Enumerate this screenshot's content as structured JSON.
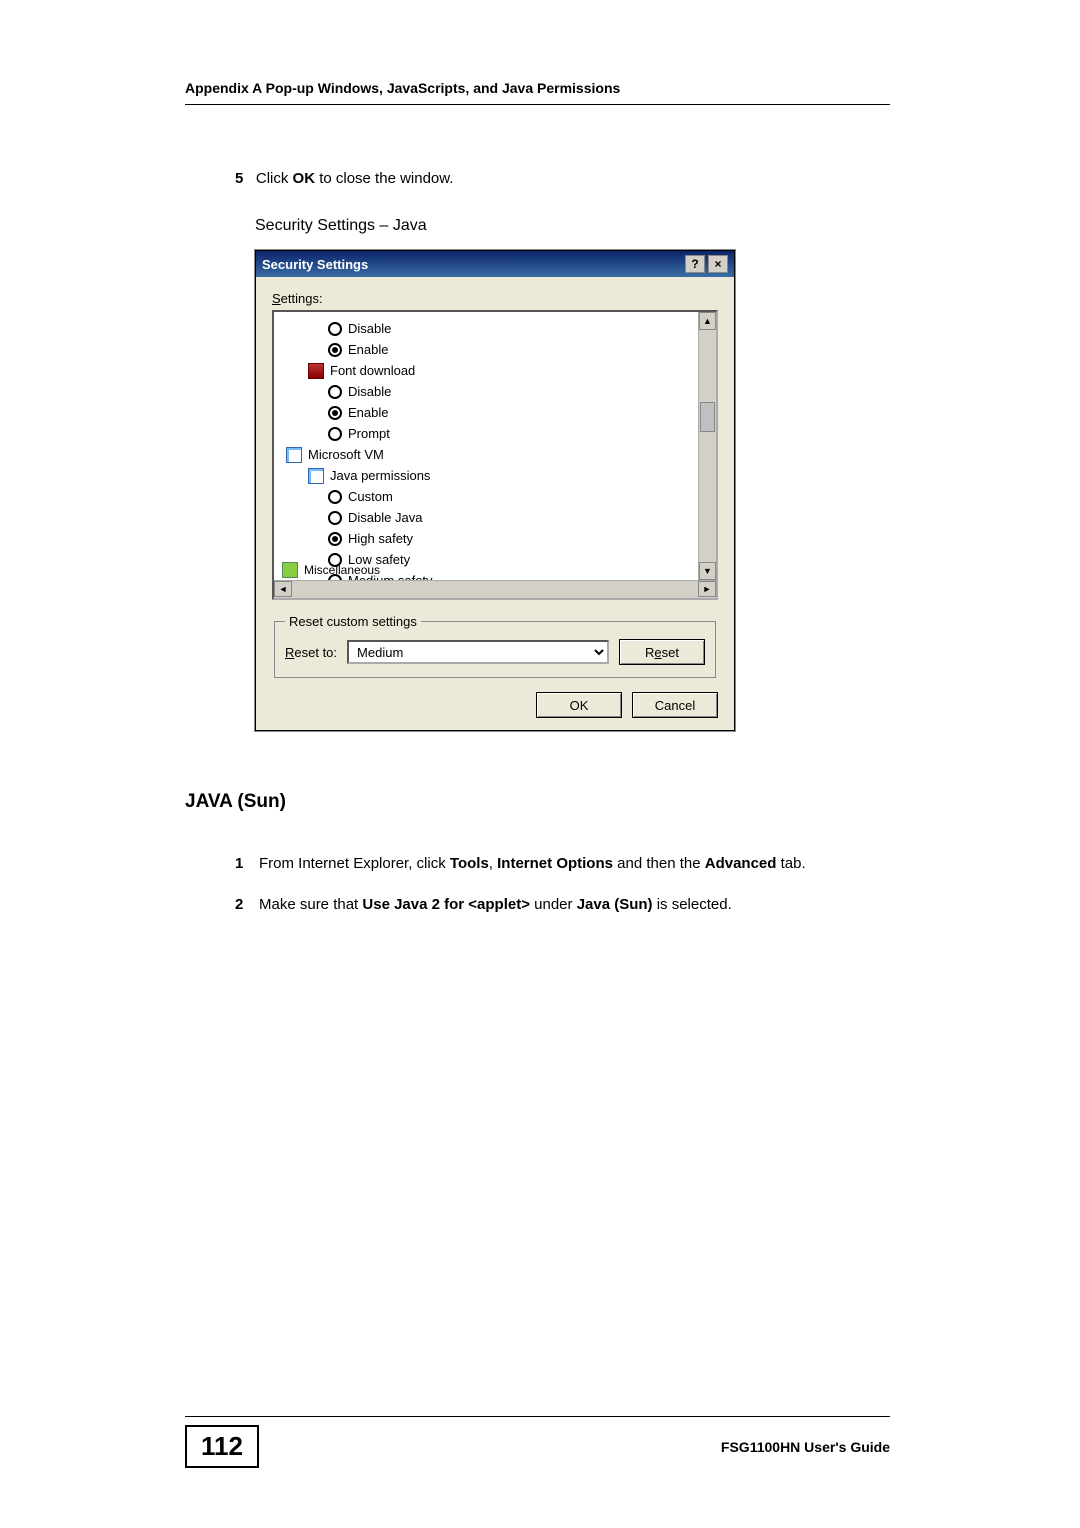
{
  "header": "Appendix A Pop-up Windows, JavaScripts, and Java Permissions",
  "step5": {
    "num": "5",
    "prefix": "Click ",
    "bold": "OK",
    "suffix": " to close the window."
  },
  "caption": "Security Settings – Java",
  "dialog": {
    "title": "Security Settings",
    "help": "?",
    "close": "×",
    "settings_label": "Settings:",
    "tree": [
      {
        "type": "radio",
        "sel": false,
        "label": "Disable",
        "indent": "ind-1"
      },
      {
        "type": "radio",
        "sel": true,
        "label": "Enable",
        "indent": "ind-1"
      },
      {
        "type": "icon",
        "icon": "icon-font",
        "label": "Font download",
        "indent": "ind-icon"
      },
      {
        "type": "radio",
        "sel": false,
        "label": "Disable",
        "indent": "ind-1"
      },
      {
        "type": "radio",
        "sel": true,
        "label": "Enable",
        "indent": "ind-1"
      },
      {
        "type": "radio",
        "sel": false,
        "label": "Prompt",
        "indent": "ind-1"
      },
      {
        "type": "icon",
        "icon": "icon-doc",
        "label": "Microsoft VM",
        "indent": "ind-0"
      },
      {
        "type": "icon",
        "icon": "icon-doc",
        "label": "Java permissions",
        "indent": "ind-icon"
      },
      {
        "type": "radio",
        "sel": false,
        "label": "Custom",
        "indent": "ind-1"
      },
      {
        "type": "radio",
        "sel": false,
        "label": "Disable Java",
        "indent": "ind-1"
      },
      {
        "type": "radio",
        "sel": true,
        "label": "High safety",
        "indent": "ind-1"
      },
      {
        "type": "radio",
        "sel": false,
        "label": "Low safety",
        "indent": "ind-1"
      },
      {
        "type": "radio",
        "sel": false,
        "label": "Medium safety",
        "indent": "ind-1"
      }
    ],
    "tree_cut_label": "Miscellaneous",
    "reset_legend": "Reset custom settings",
    "reset_to_label": "Reset to:",
    "reset_to_value": "Medium",
    "reset_btn": "Reset",
    "ok": "OK",
    "cancel": "Cancel"
  },
  "section_title": "JAVA (Sun)",
  "list": {
    "item1_num": "1",
    "item1_a": "From Internet Explorer, click ",
    "item1_b": "Tools",
    "item1_c": ", ",
    "item1_d": "Internet Options",
    "item1_e": " and then the ",
    "item1_f": "Advanced",
    "item1_g": " tab.",
    "item2_num": "2",
    "item2_a": "Make sure that ",
    "item2_b": "Use Java 2 for <applet>",
    "item2_c": " under ",
    "item2_d": "Java (Sun)",
    "item2_e": " is selected."
  },
  "footer": {
    "page": "112",
    "guide": "FSG1100HN User's Guide"
  }
}
